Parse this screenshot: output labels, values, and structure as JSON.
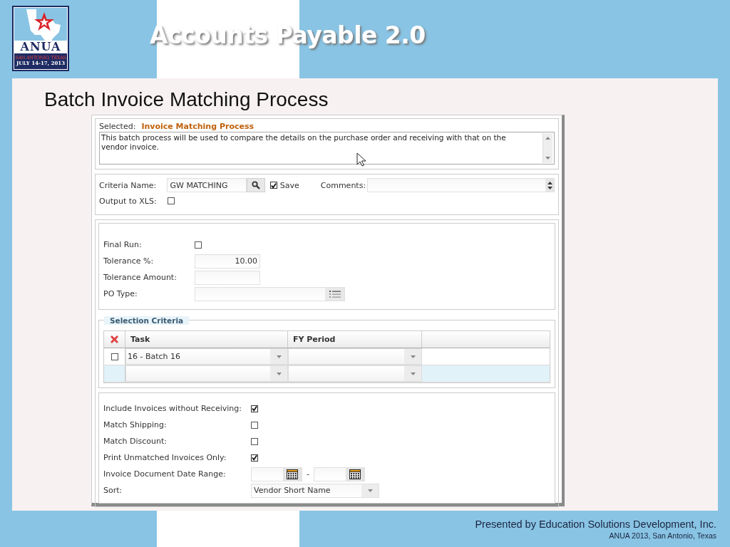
{
  "logo": {
    "name": "ANUA",
    "location": "SAN ANTONIO, TEXAS",
    "dates": "JULY 14-17, 2013"
  },
  "title": "Accounts Payable 2.0",
  "subtitle": "Batch Invoice Matching Process",
  "app": {
    "selected": {
      "label": "Selected:",
      "value": "Invoice Matching Process"
    },
    "description": "This batch process will be used to compare the details on the purchase order and receiving with that on the vendor invoice.",
    "criteria": {
      "label": "Criteria Name:",
      "value": "GW MATCHING",
      "save": {
        "label": "Save",
        "checked": true
      },
      "comments_label": "Comments:"
    },
    "output_xls": {
      "label": "Output to XLS:",
      "checked": false
    },
    "options": [
      {
        "kind": "checkbox",
        "label": "Final Run:",
        "checked": false
      },
      {
        "kind": "number",
        "label": "Tolerance %:",
        "value": "10.00"
      },
      {
        "kind": "number",
        "label": "Tolerance Amount:"
      },
      {
        "kind": "list",
        "label": "PO Type:"
      }
    ],
    "selection_criteria": {
      "title": "Selection Criteria",
      "columns": [
        "Task",
        "FY Period"
      ],
      "rows": [
        {
          "kind": "data",
          "task": "16 - Batch 16",
          "checked": false,
          "selected": false
        },
        {
          "kind": "new",
          "selected": true
        }
      ]
    },
    "filters": [
      {
        "kind": "checkbox",
        "label": "Include Invoices without Receiving:",
        "checked": true
      },
      {
        "kind": "checkbox",
        "label": "Match Shipping:",
        "checked": false
      },
      {
        "kind": "checkbox",
        "label": "Match Discount:",
        "checked": false
      },
      {
        "kind": "checkbox",
        "label": "Print Unmatched Invoices Only:",
        "checked": true
      },
      {
        "kind": "date_range",
        "label": "Invoice Document Date Range:",
        "separator": "-"
      },
      {
        "kind": "select",
        "label": "Sort:",
        "value": "Vendor Short Name"
      }
    ]
  },
  "footer": {
    "presenter": "Presented by Education Solutions Development, Inc.",
    "event": "ANUA 2013, San Antonio, Texas"
  }
}
